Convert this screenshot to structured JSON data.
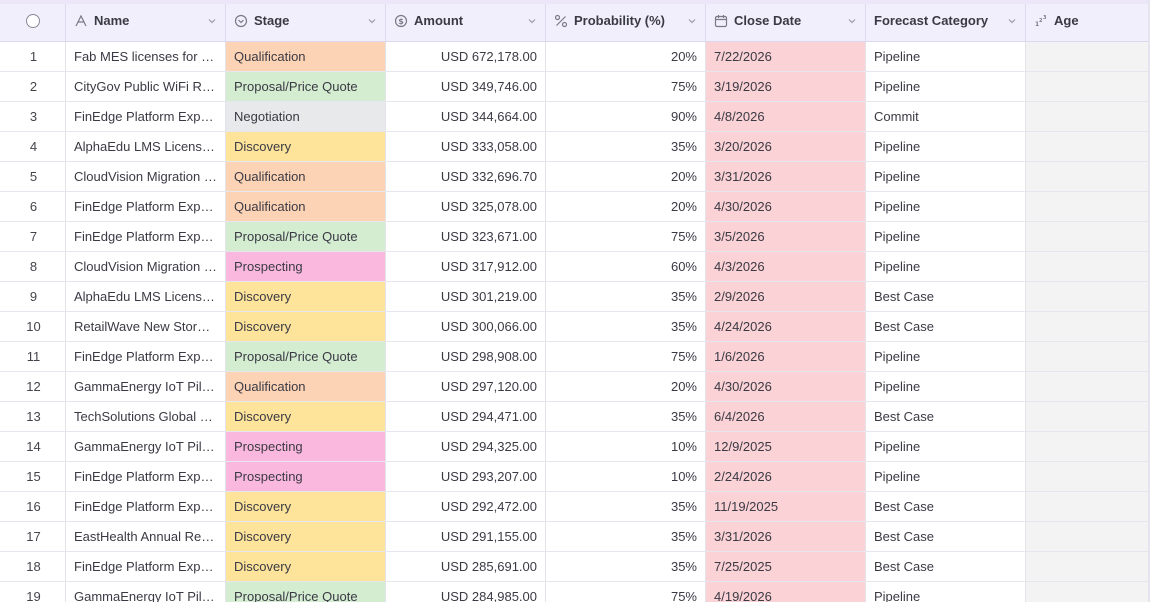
{
  "columns": {
    "name": "Name",
    "stage": "Stage",
    "amount": "Amount",
    "probability": "Probability (%)",
    "close_date": "Close Date",
    "forecast": "Forecast Category",
    "age": "Age"
  },
  "stage_colors": {
    "Qualification": "#fdd3b5",
    "Proposal/Price Quote": "#d4ecd0",
    "Negotiation": "#e8e9eb",
    "Discovery": "#fde49a",
    "Prospecting": "#fbb8de"
  },
  "close_date_color": "#fbd2d6",
  "rows": [
    {
      "num": "1",
      "name": "Fab MES licenses for M…",
      "stage": "Qualification",
      "amount": "USD 672,178.00",
      "prob": "20%",
      "date": "7/22/2026",
      "fc": "Pipeline"
    },
    {
      "num": "2",
      "name": "CityGov Public WiFi RF…",
      "stage": "Proposal/Price Quote",
      "amount": "USD 349,746.00",
      "prob": "75%",
      "date": "3/19/2026",
      "fc": "Pipeline"
    },
    {
      "num": "3",
      "name": "FinEdge Platform Expa…",
      "stage": "Negotiation",
      "amount": "USD 344,664.00",
      "prob": "90%",
      "date": "4/8/2026",
      "fc": "Commit"
    },
    {
      "num": "4",
      "name": "AlphaEdu LMS License …",
      "stage": "Discovery",
      "amount": "USD 333,058.00",
      "prob": "35%",
      "date": "3/20/2026",
      "fc": "Pipeline"
    },
    {
      "num": "5",
      "name": "CloudVision Migration …",
      "stage": "Qualification",
      "amount": "USD 332,696.70",
      "prob": "20%",
      "date": "3/31/2026",
      "fc": "Pipeline"
    },
    {
      "num": "6",
      "name": "FinEdge Platform Expa…",
      "stage": "Qualification",
      "amount": "USD 325,078.00",
      "prob": "20%",
      "date": "4/30/2026",
      "fc": "Pipeline"
    },
    {
      "num": "7",
      "name": "FinEdge Platform Expa…",
      "stage": "Proposal/Price Quote",
      "amount": "USD 323,671.00",
      "prob": "75%",
      "date": "3/5/2026",
      "fc": "Pipeline"
    },
    {
      "num": "8",
      "name": "CloudVision Migration …",
      "stage": "Prospecting",
      "amount": "USD 317,912.00",
      "prob": "60%",
      "date": "4/3/2026",
      "fc": "Pipeline"
    },
    {
      "num": "9",
      "name": "AlphaEdu LMS License …",
      "stage": "Discovery",
      "amount": "USD 301,219.00",
      "prob": "35%",
      "date": "2/9/2026",
      "fc": "Best Case"
    },
    {
      "num": "10",
      "name": "RetailWave New Store …",
      "stage": "Discovery",
      "amount": "USD 300,066.00",
      "prob": "35%",
      "date": "4/24/2026",
      "fc": "Best Case"
    },
    {
      "num": "11",
      "name": "FinEdge Platform Expa…",
      "stage": "Proposal/Price Quote",
      "amount": "USD 298,908.00",
      "prob": "75%",
      "date": "1/6/2026",
      "fc": "Pipeline"
    },
    {
      "num": "12",
      "name": "GammaEnergy IoT Pilo…",
      "stage": "Qualification",
      "amount": "USD 297,120.00",
      "prob": "20%",
      "date": "4/30/2026",
      "fc": "Pipeline"
    },
    {
      "num": "13",
      "name": "TechSolutions Global …",
      "stage": "Discovery",
      "amount": "USD 294,471.00",
      "prob": "35%",
      "date": "6/4/2026",
      "fc": "Best Case"
    },
    {
      "num": "14",
      "name": "GammaEnergy IoT Pilo…",
      "stage": "Prospecting",
      "amount": "USD 294,325.00",
      "prob": "10%",
      "date": "12/9/2025",
      "fc": "Pipeline"
    },
    {
      "num": "15",
      "name": "FinEdge Platform Expa…",
      "stage": "Prospecting",
      "amount": "USD 293,207.00",
      "prob": "10%",
      "date": "2/24/2026",
      "fc": "Pipeline"
    },
    {
      "num": "16",
      "name": "FinEdge Platform Expa…",
      "stage": "Discovery",
      "amount": "USD 292,472.00",
      "prob": "35%",
      "date": "11/19/2025",
      "fc": "Best Case"
    },
    {
      "num": "17",
      "name": "EastHealth Annual Ren…",
      "stage": "Discovery",
      "amount": "USD 291,155.00",
      "prob": "35%",
      "date": "3/31/2026",
      "fc": "Best Case"
    },
    {
      "num": "18",
      "name": "FinEdge Platform Expa…",
      "stage": "Discovery",
      "amount": "USD 285,691.00",
      "prob": "35%",
      "date": "7/25/2025",
      "fc": "Best Case"
    },
    {
      "num": "19",
      "name": "GammaEnergy IoT Pilo…",
      "stage": "Proposal/Price Quote",
      "amount": "USD 284,985.00",
      "prob": "75%",
      "date": "4/19/2026",
      "fc": "Pipeline"
    }
  ]
}
